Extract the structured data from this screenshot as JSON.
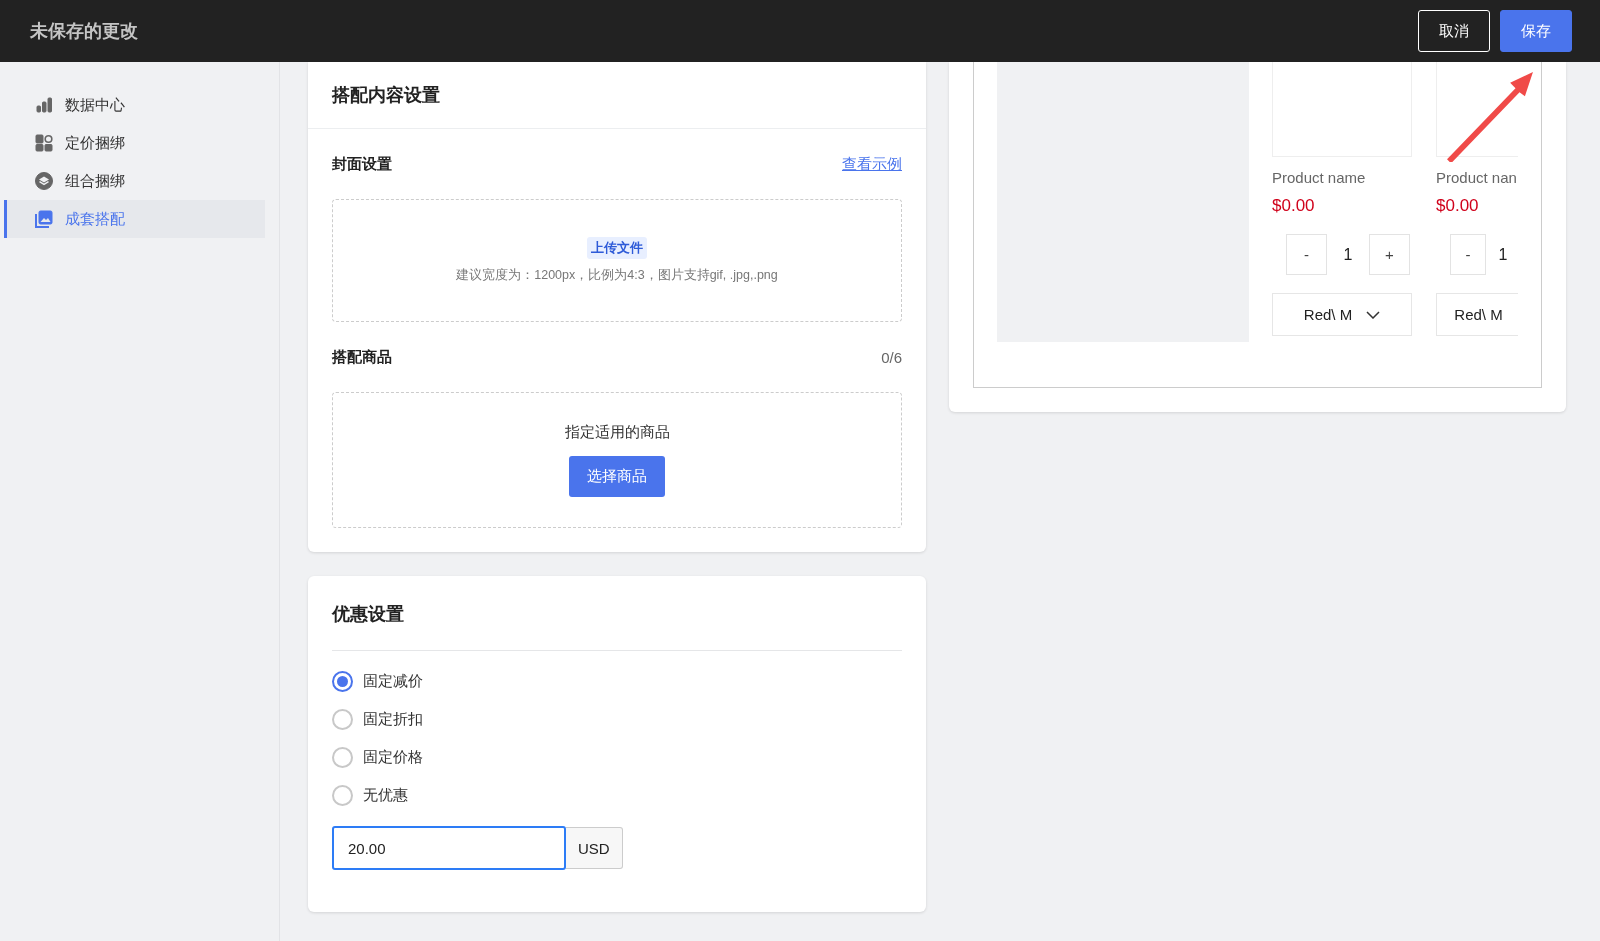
{
  "top_bar": {
    "title": "未保存的更改",
    "buttons": [
      {
        "label": "取消",
        "kind": "secondary"
      },
      {
        "label": "保存",
        "kind": "primary"
      }
    ]
  },
  "sidebar": {
    "items": [
      {
        "label": "数据中心",
        "selected": false
      },
      {
        "label": "定价捆绑",
        "selected": false
      },
      {
        "label": "组合捆绑",
        "selected": false
      },
      {
        "label": "成套搭配",
        "selected": true
      }
    ]
  },
  "content_card": {
    "title": "搭配内容设置",
    "cover": {
      "label": "封面设置",
      "link": "查看示例",
      "upload_button": "上传文件",
      "hint": "建议宽度为：1200px，比例为4:3，图片支持gif, .jpg,.png"
    },
    "products": {
      "label": "搭配商品",
      "count": "0/6",
      "empty_text": "指定适用的商品",
      "button": "选择商品"
    }
  },
  "discount_card": {
    "title": "优惠设置",
    "options": [
      {
        "label": "固定减价",
        "selected": true
      },
      {
        "label": "固定折扣",
        "selected": false
      },
      {
        "label": "固定价格",
        "selected": false
      },
      {
        "label": "无优惠",
        "selected": false
      }
    ],
    "amount": {
      "value": "20.00",
      "unit": "USD"
    }
  },
  "preview": {
    "products": [
      {
        "name": "Product name",
        "price": "$0.00",
        "minus": "-",
        "quantity": "1",
        "plus": "+",
        "variant": "Red\\ M",
        "kind": "full"
      },
      {
        "name": "Product nan",
        "price": "$0.00",
        "minus": "-",
        "quantity": "1",
        "variant": "Red\\ M",
        "kind": "clipped"
      }
    ]
  }
}
